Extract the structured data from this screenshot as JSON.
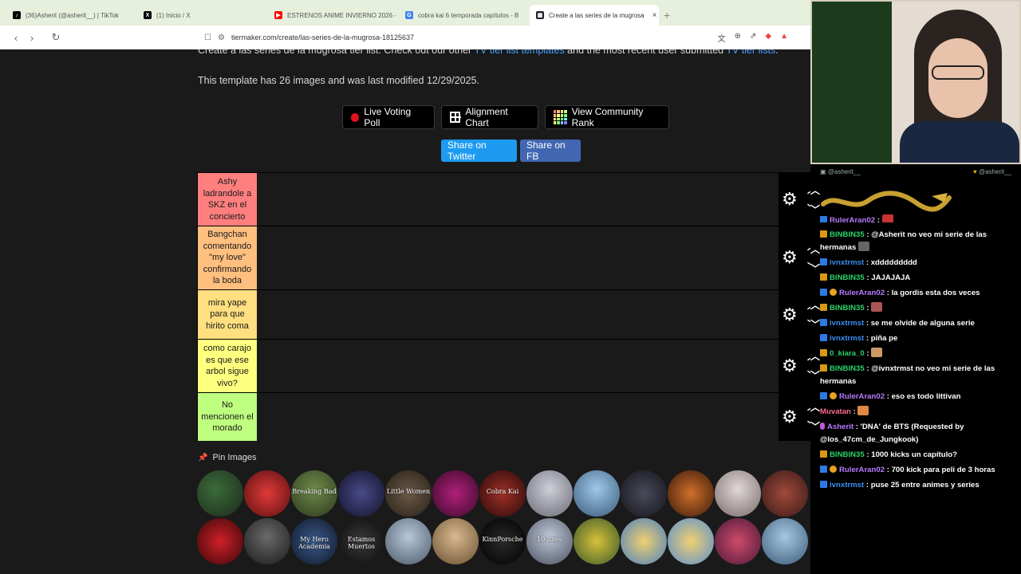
{
  "browser": {
    "tabs": [
      {
        "label": "(36)Asherit (@asherit__) | TikTok",
        "fav_color": "#000000",
        "fav_glyph": "♪"
      },
      {
        "label": "(1) Inicio / X",
        "fav_color": "#000000",
        "fav_glyph": "X"
      },
      {
        "label": "ESTRENOS ANIME INVIERNO 2026 -",
        "fav_color": "#ff0000",
        "fav_glyph": "▶"
      },
      {
        "label": "cobra kai 6 temporada capítulos - B",
        "fav_color": "#4285f4",
        "fav_glyph": "G"
      },
      {
        "label": "Create a las series de la mugrosa",
        "fav_color": "#222222",
        "fav_glyph": "▦"
      }
    ],
    "tab_close": "×",
    "new_tab": "+",
    "url": "tiermaker.com/create/las-series-de-la-mugrosa-18125637",
    "nav": {
      "back": "‹",
      "forward": "›",
      "reload": "↻"
    }
  },
  "page": {
    "desc_prefix": "Create a las series de la mugrosa tier list. Check out our other ",
    "desc_link1": "TV tier list templates",
    "desc_mid": " and the most recent user submitted ",
    "desc_link2": "TV tier lists",
    "desc_end": ".",
    "template_info": "This template has 26 images and was last modified 12/29/2025.",
    "buttons": {
      "live_voting": "Live Voting Poll",
      "alignment": "Alignment Chart",
      "community": "View Community Rank",
      "share_twitter": "Share on Twitter",
      "share_fb": "Share on FB"
    },
    "colors": {
      "twitter": "#1d9bf0",
      "facebook": "#4267b2",
      "link": "#4aa3ff"
    },
    "tiers": [
      {
        "label": "Ashy ladrandole a SKZ en el concierto",
        "color": "#ff7f7f"
      },
      {
        "label": "Bangchan comentando \"my love\" confirmando la boda",
        "color": "#ffbf7f"
      },
      {
        "label": "mira yape para que hirito coma",
        "color": "#ffdf7f"
      },
      {
        "label": "como carajo es que ese arbol sigue vivo?",
        "color": "#ffff7f"
      },
      {
        "label": "No mencionen el morado",
        "color": "#bfff7f"
      }
    ],
    "pin_images": "Pin Images",
    "thumbs_row1": [
      "",
      "",
      "Breaking Bad",
      "",
      "Little Women",
      "",
      "Cobra Kai",
      "",
      "",
      "",
      "",
      "",
      ""
    ],
    "thumbs_row2": [
      "",
      "",
      "My Hero Academia",
      "Estamos Muertos",
      "",
      "",
      "KinnPorsche",
      "10 lines",
      "",
      "",
      "",
      "",
      ""
    ]
  },
  "chat": {
    "user_left": "@asherit__",
    "user_right": "@asherit__",
    "messages": [
      {
        "user": "RulerAran02",
        "color": "#b77cff",
        "badge": "b",
        "text": ""
      },
      {
        "user": "BINBIN35",
        "color": "#2bd46a",
        "badge": "g",
        "text": "@Asherit no veo mi serie de las hermanas"
      },
      {
        "user": "ivnxtrmst",
        "color": "#3a8ff0",
        "badge": "b",
        "text": "xddddddddd"
      },
      {
        "user": "BINBIN35",
        "color": "#2bd46a",
        "badge": "g",
        "text": "JAJAJAJA"
      },
      {
        "user": "RulerAran02",
        "color": "#b77cff",
        "badge": "b",
        "text": "la gordis esta dos veces"
      },
      {
        "user": "BINBIN35",
        "color": "#2bd46a",
        "badge": "g",
        "text": ""
      },
      {
        "user": "ivnxtrmst",
        "color": "#3a8ff0",
        "badge": "b",
        "text": "se me olvide de alguna serie"
      },
      {
        "user": "ivnxtrmst",
        "color": "#3a8ff0",
        "badge": "b",
        "text": "piña pe"
      },
      {
        "user": "0_kiara_0",
        "color": "#2bd46a",
        "badge": "g",
        "text": ""
      },
      {
        "user": "BINBIN35",
        "color": "#2bd46a",
        "badge": "g",
        "text": "@ivnxtrmst no veo mi serie de las hermanas"
      },
      {
        "user": "RulerAran02",
        "color": "#b77cff",
        "badge": "b",
        "text": "eso es todo littivan"
      },
      {
        "user": "Muvatan",
        "color": "#ff6b8a",
        "badge": "mic",
        "text": ""
      },
      {
        "user": "Asherit",
        "color": "#b77cff",
        "badge": "mic",
        "text": "'DNA' de BTS (Requested by @los_47cm_de_Jungkook)"
      },
      {
        "user": "BINBIN35",
        "color": "#2bd46a",
        "badge": "g",
        "text": "1000 kicks un capítulo?"
      },
      {
        "user": "RulerAran02",
        "color": "#b77cff",
        "badge": "b",
        "text": "700 kick para peli de 3 horas"
      },
      {
        "user": "ivnxtrmst",
        "color": "#3a8ff0",
        "badge": "b",
        "text": "puse 25 entre animes y series"
      }
    ]
  }
}
